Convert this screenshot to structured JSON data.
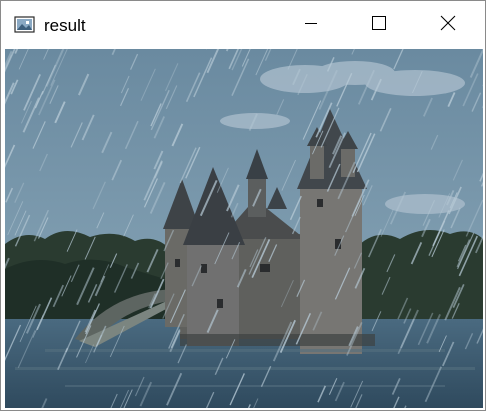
{
  "window": {
    "title": "result",
    "icon": "image-window-icon",
    "controls": {
      "minimize": "minimize-icon",
      "maximize": "maximize-icon",
      "close": "close-icon"
    }
  },
  "image": {
    "description_name": "rain-filtered-castle-image"
  },
  "colors": {
    "sky": "#6f8ea3",
    "rain": "#b7cad6",
    "water": "#3e5a70",
    "stone": "#6c6c6a",
    "trees": "#25362c"
  }
}
